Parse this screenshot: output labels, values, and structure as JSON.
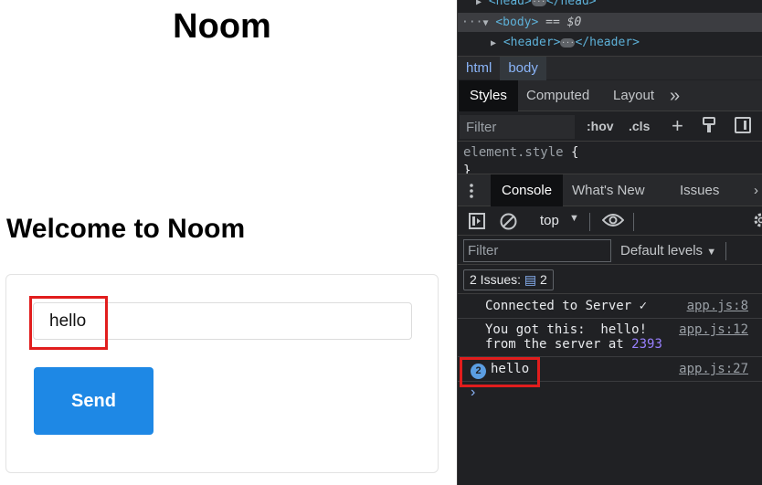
{
  "page": {
    "title": "Noom",
    "welcome": "Welcome to Noom",
    "input_value": "hello",
    "send_label": "Send"
  },
  "devtools": {
    "elements": {
      "head_open": "<head>",
      "head_close": "</head>",
      "body_tag": "<body>",
      "body_selected": "== $0",
      "header_open": "<header>",
      "header_close": "</header>",
      "ellipsis": "···"
    },
    "breadcrumbs": [
      "html",
      "body"
    ],
    "styles_tabs": {
      "styles": "Styles",
      "computed": "Computed",
      "layout": "Layout",
      "more": "»"
    },
    "styles_filter_placeholder": "Filter",
    "styles_tools": {
      "hov": ":hov",
      "cls": ".cls",
      "add": "+"
    },
    "element_style": {
      "selector": "element.style",
      "open": "{",
      "close": "}"
    },
    "console_tabs": {
      "console": "Console",
      "whats_new": "What's New",
      "issues": "Issues"
    },
    "context": "top",
    "console_filter_placeholder": "Filter",
    "default_levels": "Default levels",
    "issues_label": "2 Issues:",
    "issues_count": "2",
    "logs": [
      {
        "text": "Connected to Server ✓",
        "source": "app.js:8"
      },
      {
        "text_line1": "You got this:  hello!",
        "text_line2_prefix": "from the server at ",
        "text_line2_num": "2393",
        "source": "app.js:12"
      },
      {
        "count": "2",
        "text": "hello",
        "source": "app.js:27"
      }
    ],
    "prompt": "›"
  },
  "colors": {
    "send_button": "#1e88e5",
    "highlight": "#e11d1d",
    "devtools_bg": "#202124",
    "tag_color": "#5db0d7"
  }
}
